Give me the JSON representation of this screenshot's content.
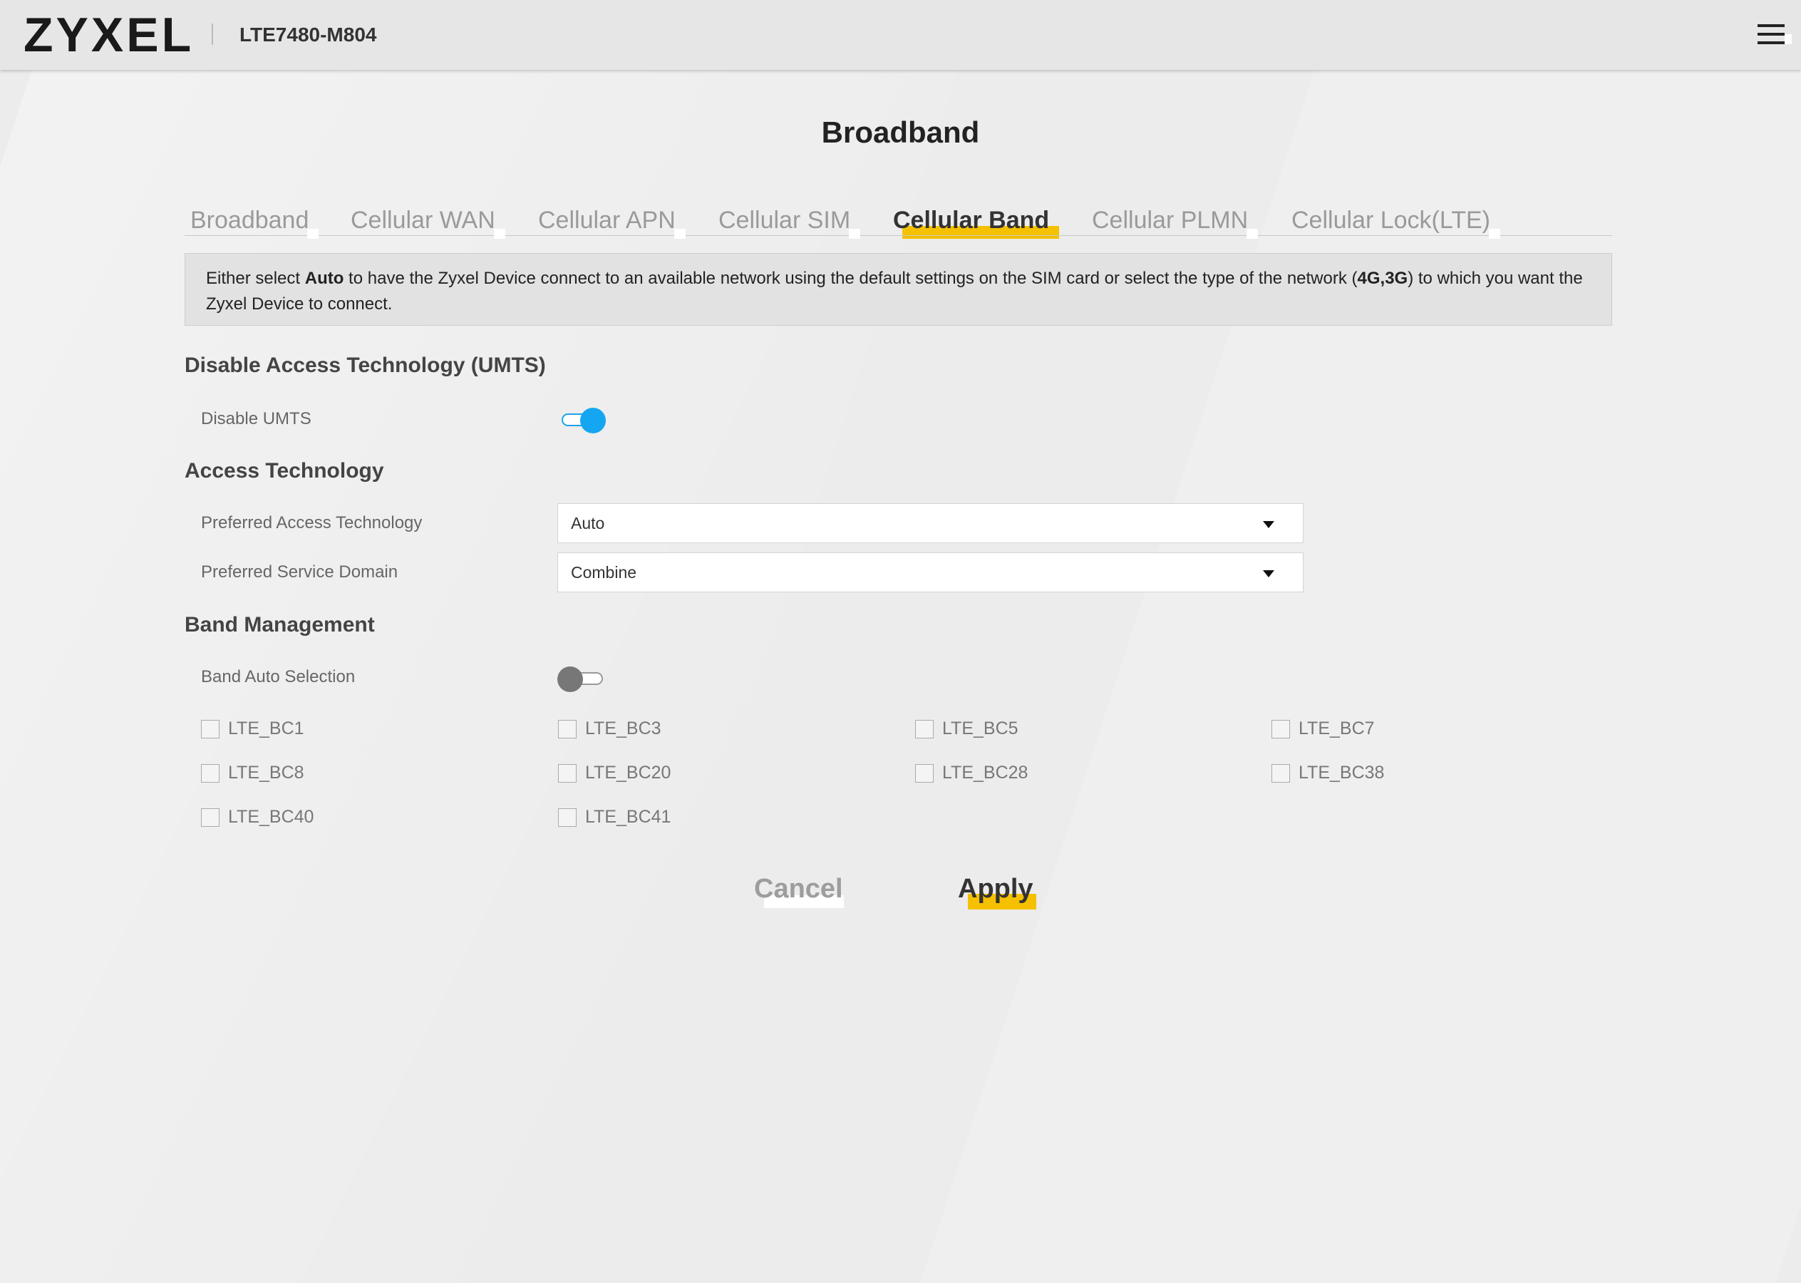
{
  "header": {
    "brand": "ZYXEL",
    "model": "LTE7480-M804"
  },
  "page": {
    "title": "Broadband"
  },
  "tabs": [
    {
      "label": "Broadband",
      "active": false
    },
    {
      "label": "Cellular WAN",
      "active": false
    },
    {
      "label": "Cellular APN",
      "active": false
    },
    {
      "label": "Cellular SIM",
      "active": false
    },
    {
      "label": "Cellular Band",
      "active": true
    },
    {
      "label": "Cellular PLMN",
      "active": false
    },
    {
      "label": "Cellular Lock(LTE)",
      "active": false
    }
  ],
  "info": {
    "part1": "Either select ",
    "bold1": "Auto",
    "part2": " to have the Zyxel Device connect to an available network using the default settings on the SIM card or select the type of the network (",
    "bold2": "4G,3G",
    "part3": ") to which you want the Zyxel Device to connect."
  },
  "umts": {
    "section_title": "Disable Access Technology (UMTS)",
    "disable_umts_label": "Disable UMTS",
    "disable_umts_on": true
  },
  "access": {
    "section_title": "Access Technology",
    "pref_tech_label": "Preferred Access Technology",
    "pref_tech_value": "Auto",
    "pref_domain_label": "Preferred Service Domain",
    "pref_domain_value": "Combine"
  },
  "band": {
    "section_title": "Band Management",
    "auto_label": "Band Auto Selection",
    "auto_on": false,
    "bands": [
      {
        "label": "LTE_BC1",
        "checked": false
      },
      {
        "label": "LTE_BC3",
        "checked": false
      },
      {
        "label": "LTE_BC5",
        "checked": false
      },
      {
        "label": "LTE_BC7",
        "checked": false
      },
      {
        "label": "LTE_BC8",
        "checked": false
      },
      {
        "label": "LTE_BC20",
        "checked": false
      },
      {
        "label": "LTE_BC28",
        "checked": false
      },
      {
        "label": "LTE_BC38",
        "checked": false
      },
      {
        "label": "LTE_BC40",
        "checked": false
      },
      {
        "label": "LTE_BC41",
        "checked": false
      }
    ]
  },
  "actions": {
    "cancel": "Cancel",
    "apply": "Apply"
  },
  "colors": {
    "accent_yellow": "#f5c000",
    "toggle_blue": "#14a6f0"
  }
}
